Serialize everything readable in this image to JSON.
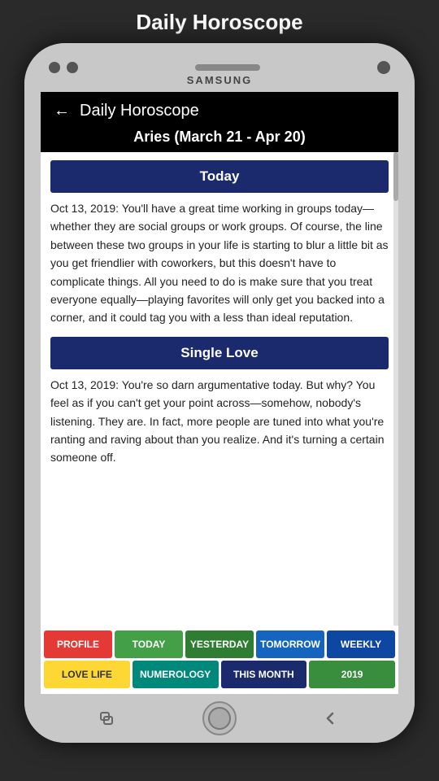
{
  "page": {
    "title": "Daily Horoscope"
  },
  "header": {
    "back_label": "←",
    "title": "Daily Horoscope",
    "zodiac": "Aries (March 21 - Apr 20)"
  },
  "sections": [
    {
      "header": "Today",
      "text": "Oct 13, 2019: You'll have a great time working in groups today—whether they are social groups or work groups. Of course, the line between these two groups in your life is starting to blur a little bit as you get friendlier with coworkers, but this doesn't have to complicate things. All you need to do is make sure that you treat everyone equally—playing favorites will only get you backed into a corner, and it could tag you with a less than ideal reputation."
    },
    {
      "header": "Single Love",
      "text": "Oct 13, 2019: You're so darn argumentative today. But why? You feel as if you can't get your point across—somehow, nobody's listening. They are. In fact, more people are tuned into what you're ranting and raving about than you realize. And it's turning a certain someone off."
    }
  ],
  "nav_row1": [
    {
      "label": "PROFILE",
      "style": "btn-red"
    },
    {
      "label": "TODAY",
      "style": "btn-green"
    },
    {
      "label": "YESTERDAY",
      "style": "btn-green2"
    },
    {
      "label": "TOMORROW",
      "style": "btn-blue"
    },
    {
      "label": "WEEKLY",
      "style": "btn-darkblue"
    }
  ],
  "nav_row2": [
    {
      "label": "LOVE LIFE",
      "style": "btn-yellow"
    },
    {
      "label": "NUMEROLOGY",
      "style": "btn-teal"
    },
    {
      "label": "THIS MONTH",
      "style": "btn-navy"
    },
    {
      "label": "2019",
      "style": "btn-green3"
    }
  ],
  "phone": {
    "brand": "SAMSUNG"
  }
}
